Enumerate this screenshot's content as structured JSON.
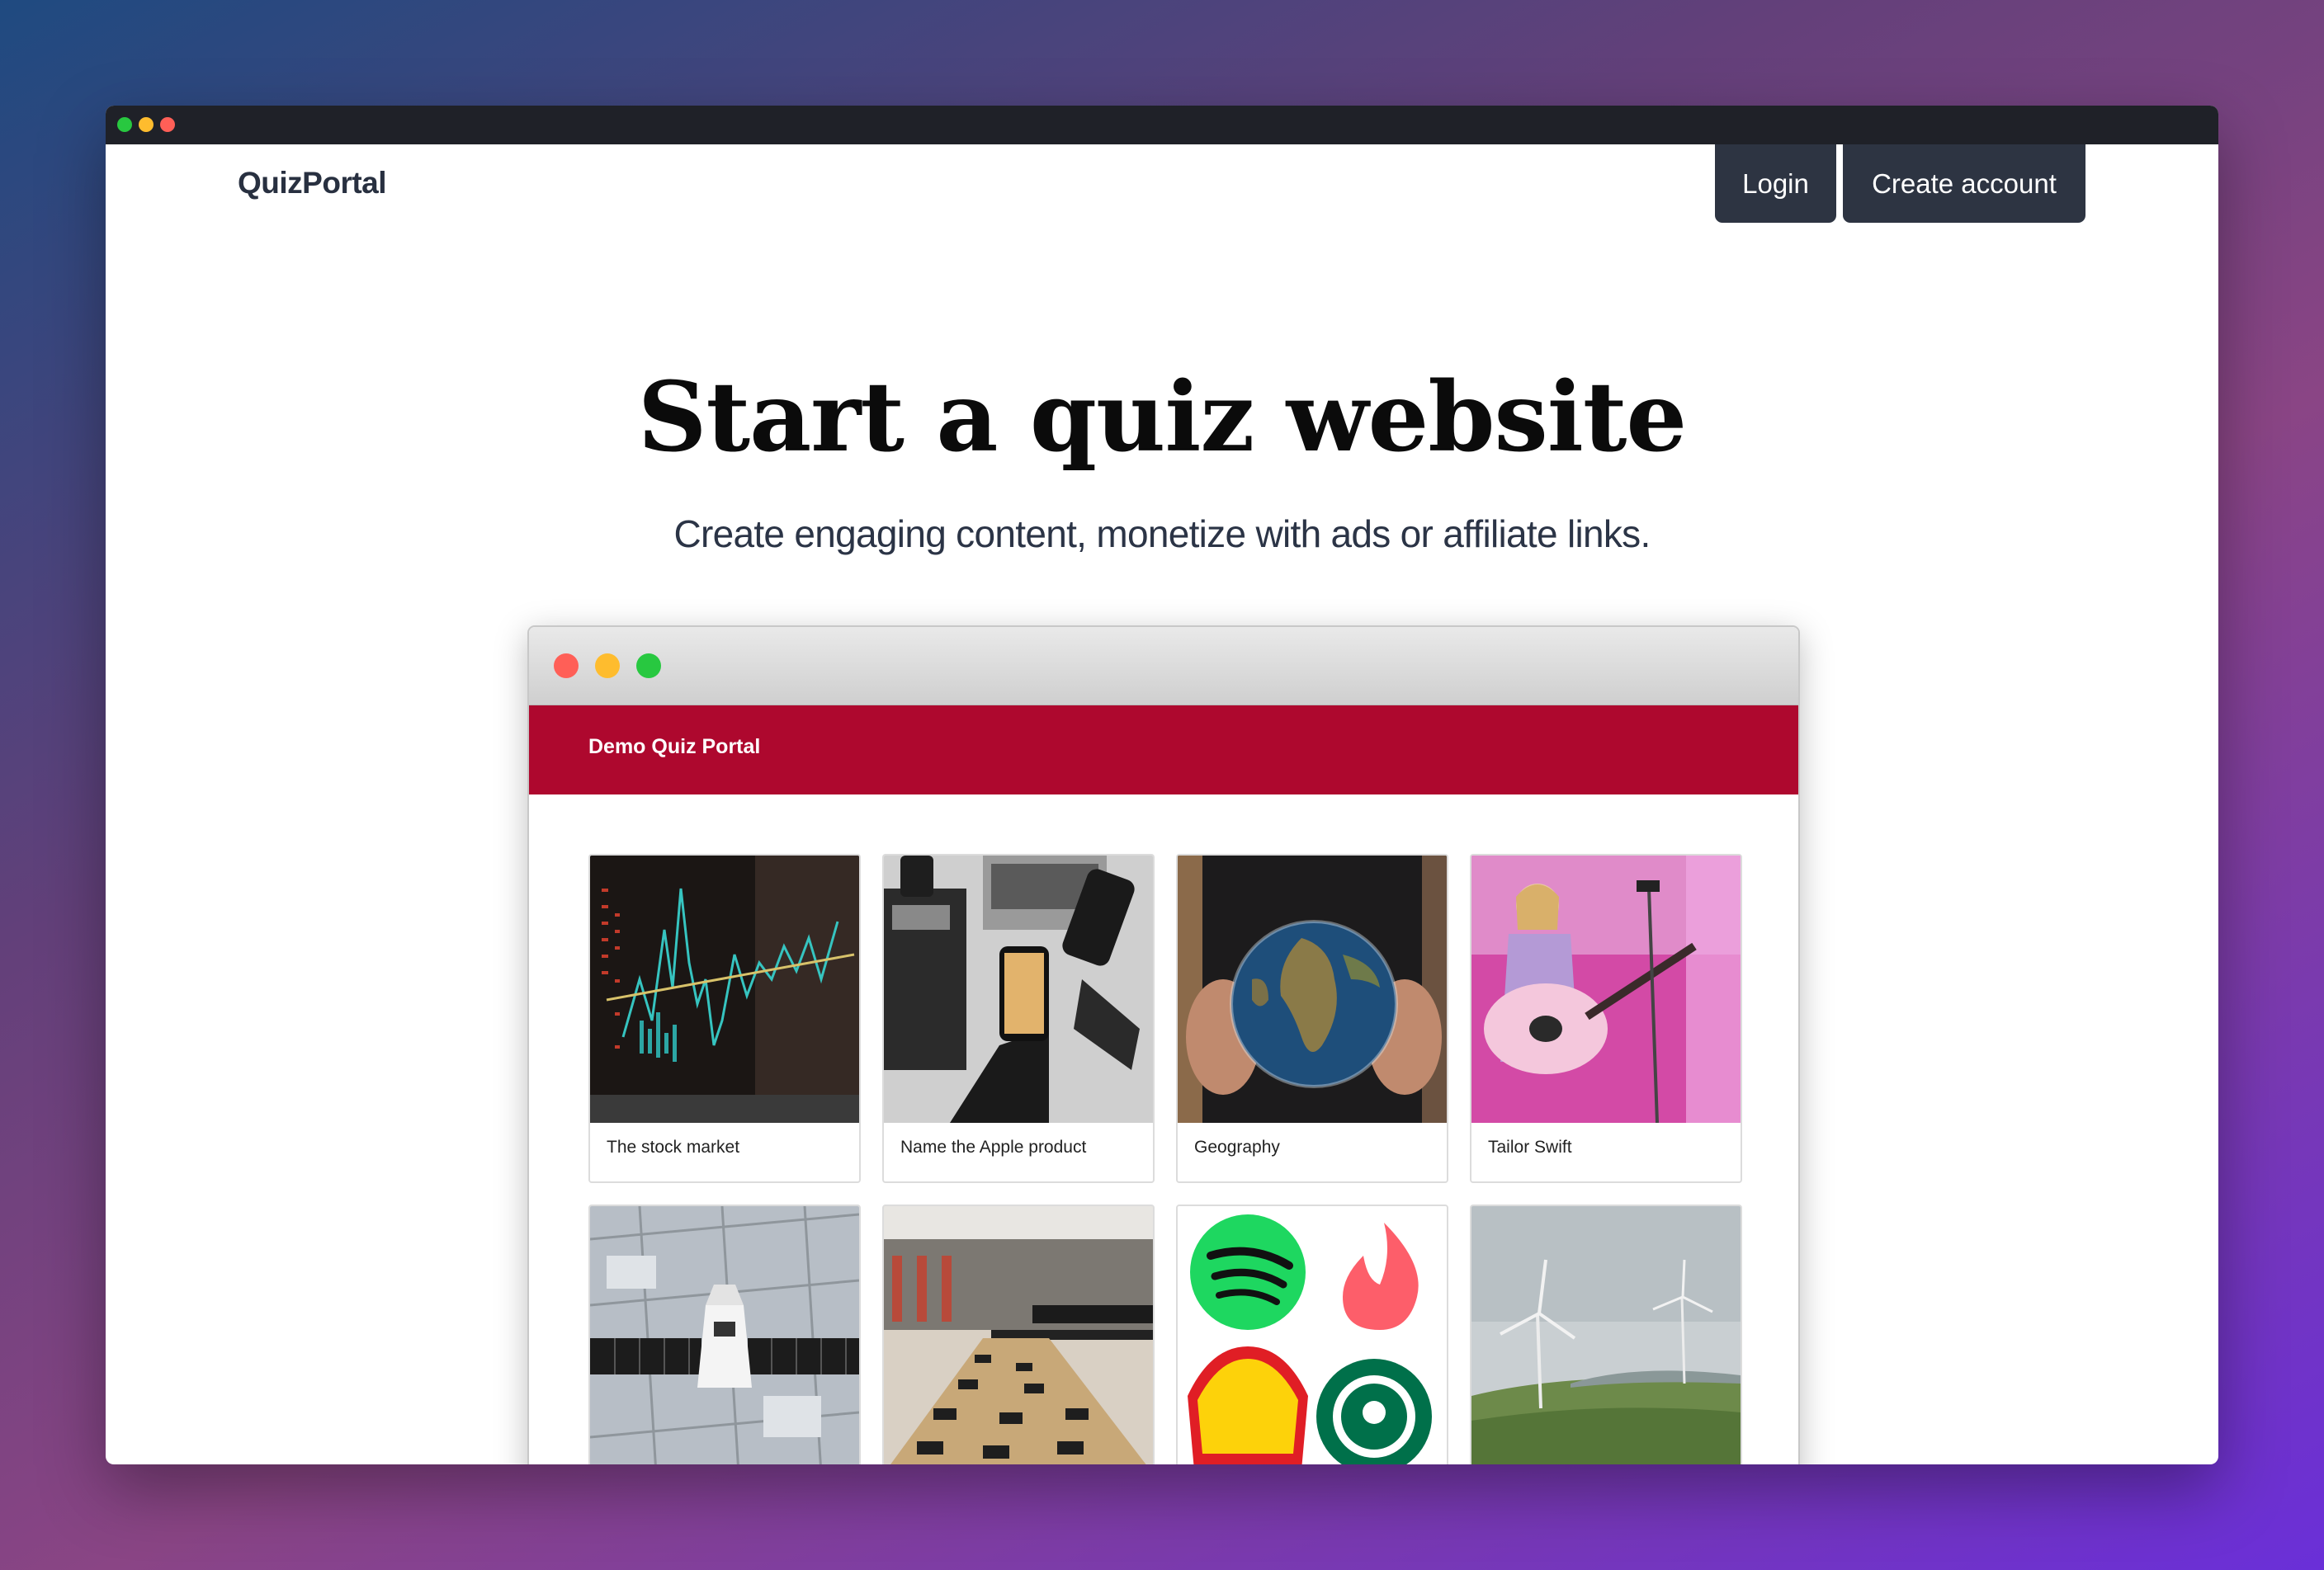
{
  "window": {
    "traffic_lights": [
      "#28c840",
      "#febc2e",
      "#ff5f57"
    ]
  },
  "navbar": {
    "brand": "QuizPortal",
    "login_label": "Login",
    "create_account_label": "Create account"
  },
  "hero": {
    "title": "Start a quiz website",
    "subtitle": "Create engaging content, monetize with ads or affiliate links."
  },
  "demo": {
    "traffic_lights": [
      "#ff5f57",
      "#febc2e",
      "#28c840"
    ],
    "header_color": "#ae082e",
    "site_title": "Demo Quiz Portal",
    "cards": [
      {
        "label": "The stock market",
        "image": "stock-chart"
      },
      {
        "label": "Name the Apple product",
        "image": "phone-desk"
      },
      {
        "label": "Geography",
        "image": "globe-hands"
      },
      {
        "label": "Tailor Swift",
        "image": "singer-guitar"
      },
      {
        "label": "",
        "image": "satellite"
      },
      {
        "label": "",
        "image": "race-track"
      },
      {
        "label": "",
        "image": "brand-logos"
      },
      {
        "label": "",
        "image": "wind-turbines"
      }
    ]
  }
}
